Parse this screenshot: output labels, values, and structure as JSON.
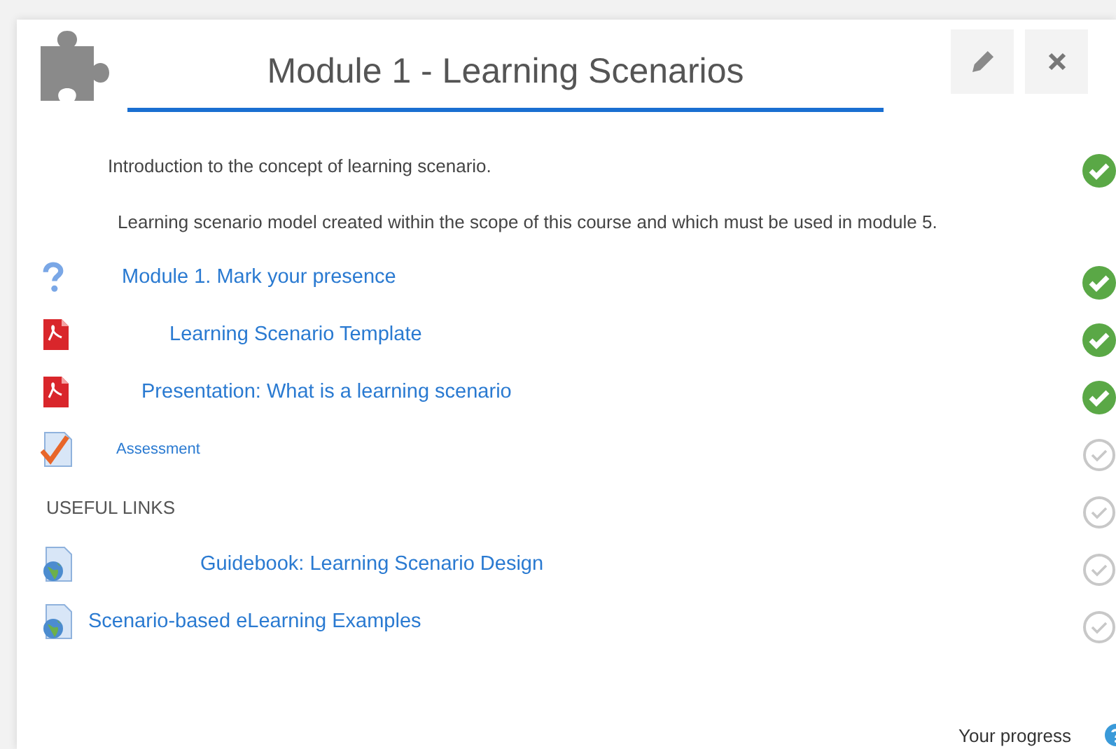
{
  "header": {
    "title": "Module 1 - Learning Scenarios"
  },
  "items": [
    {
      "kind": "text",
      "label": "Introduction to the concept of learning scenario.",
      "completed": true
    },
    {
      "kind": "text",
      "label": "Learning scenario model created within the scope of this course and which must be used in module 5."
    },
    {
      "kind": "quiz",
      "label": "Module 1. Mark your presence",
      "completed": true
    },
    {
      "kind": "pdf",
      "label": "Learning Scenario Template",
      "completed": true
    },
    {
      "kind": "pdf",
      "label": "Presentation: What is a learning scenario",
      "completed": true
    },
    {
      "kind": "assign",
      "label": "Assessment",
      "completed": false
    },
    {
      "kind": "heading",
      "label": "USEFUL LINKS",
      "completed": false
    },
    {
      "kind": "url",
      "label": "Guidebook: Learning Scenario Design",
      "completed": false
    },
    {
      "kind": "url",
      "label": "Scenario-based eLearning Examples",
      "completed": false
    }
  ],
  "footer": {
    "progress_label": "Your progress"
  }
}
